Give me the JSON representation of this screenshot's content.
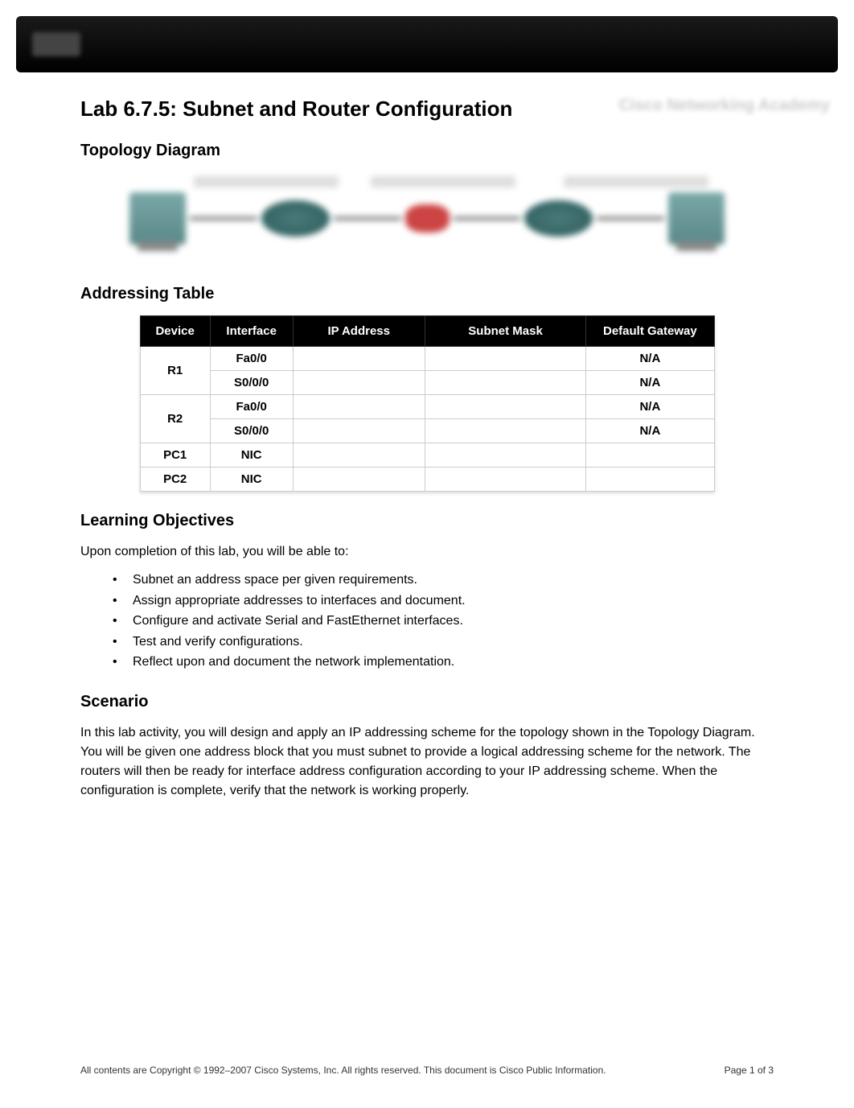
{
  "watermark": "Cisco Networking Academy",
  "title": "Lab 6.7.5: Subnet and Router Configuration",
  "sections": {
    "topology_heading": "Topology Diagram",
    "addressing_heading": "Addressing Table",
    "objectives_heading": "Learning Objectives",
    "scenario_heading": "Scenario"
  },
  "table": {
    "headers": {
      "device": "Device",
      "interface": "Interface",
      "ip": "IP Address",
      "mask": "Subnet Mask",
      "gateway": "Default Gateway"
    },
    "rows": [
      {
        "device": "R1",
        "interface": "Fa0/0",
        "ip": "",
        "mask": "",
        "gateway": "N/A",
        "rowspan_device": 2
      },
      {
        "device": "",
        "interface": "S0/0/0",
        "ip": "",
        "mask": "",
        "gateway": "N/A"
      },
      {
        "device": "R2",
        "interface": "Fa0/0",
        "ip": "",
        "mask": "",
        "gateway": "N/A",
        "rowspan_device": 2
      },
      {
        "device": "",
        "interface": "S0/0/0",
        "ip": "",
        "mask": "",
        "gateway": "N/A"
      },
      {
        "device": "PC1",
        "interface": "NIC",
        "ip": "",
        "mask": "",
        "gateway": ""
      },
      {
        "device": "PC2",
        "interface": "NIC",
        "ip": "",
        "mask": "",
        "gateway": ""
      }
    ]
  },
  "objectives": {
    "intro": "Upon completion of this lab, you will be able to:",
    "items": [
      "Subnet an address space per given requirements.",
      "Assign appropriate addresses to interfaces and document.",
      "Configure and activate Serial and FastEthernet interfaces.",
      "Test and verify configurations.",
      "Reflect upon and document the network implementation."
    ]
  },
  "scenario_text": "In this lab activity, you will design and apply an IP addressing scheme for the topology shown in the Topology Diagram. You will be given one address block that you must subnet to provide a logical addressing scheme for the network. The routers will then be ready for interface address configuration according to your IP addressing scheme. When the configuration is complete, verify that the network is working properly.",
  "footer": {
    "copyright": "All contents are Copyright © 1992–2007 Cisco Systems, Inc. All rights reserved. This document is Cisco Public Information.",
    "page": "Page 1 of 3"
  }
}
